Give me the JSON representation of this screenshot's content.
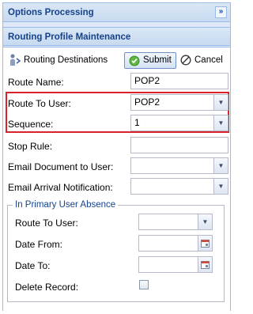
{
  "panel_title": "Options Processing",
  "section_title": "Routing Profile Maintenance",
  "icons": {
    "collapse": "double-chevron-right-icon",
    "routing": "people-route-icon",
    "submit": "check-circle-icon",
    "cancel": "cancel-circle-icon",
    "combo": "chevron-down-icon",
    "date": "calendar-icon"
  },
  "colors": {
    "header_text": "#15428b",
    "highlight_border": "#d9222a",
    "submit_check": "#3a9b2c"
  },
  "toolbar": {
    "routing_destinations": "Routing Destinations",
    "submit": "Submit",
    "cancel": "Cancel"
  },
  "form": {
    "route_name": {
      "label": "Route Name:",
      "value": "POP2"
    },
    "route_to_user": {
      "label": "Route To User:",
      "value": "POP2"
    },
    "sequence": {
      "label": "Sequence:",
      "value": "1"
    },
    "stop_rule": {
      "label": "Stop Rule:",
      "value": ""
    },
    "email_document": {
      "label": "Email Document to User:",
      "value": ""
    },
    "email_arrival": {
      "label": "Email Arrival Notification:",
      "value": ""
    }
  },
  "absence": {
    "legend": "In Primary User Absence",
    "route_to_user": {
      "label": "Route To User:",
      "value": ""
    },
    "date_from": {
      "label": "Date From:",
      "value": ""
    },
    "date_to": {
      "label": "Date To:",
      "value": ""
    },
    "delete_record": {
      "label": "Delete Record:",
      "checked": false
    }
  }
}
